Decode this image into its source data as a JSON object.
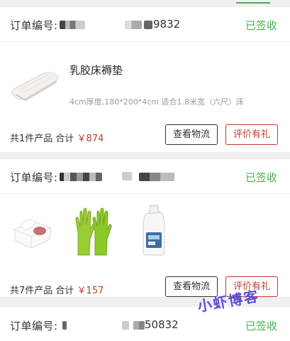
{
  "orders": [
    {
      "order_label": "订单编号:",
      "order_number_visible": "9832",
      "status": "已签收",
      "product": {
        "title": "乳胶床褥垫",
        "spec": "4cm厚度,180*200*4cm 适合1.8米宽（六尺）床"
      },
      "summary_prefix": "共1件产品 合计",
      "price": "￥874",
      "track_button": "查看物流",
      "review_button": "评价有礼"
    },
    {
      "order_label": "订单编号:",
      "order_number_visible": "",
      "status": "已签收",
      "summary_prefix": "共7件产品 合计",
      "price": "￥157",
      "track_button": "查看物流",
      "review_button": "评价有礼"
    },
    {
      "order_label": "订单编号:",
      "order_number_visible": "50832",
      "status": "已签收"
    }
  ],
  "watermark": "小虾博客",
  "colors": {
    "accent_green": "#4caf50",
    "price_red": "#c0392b",
    "watermark_purple": "#4b3bd6"
  }
}
